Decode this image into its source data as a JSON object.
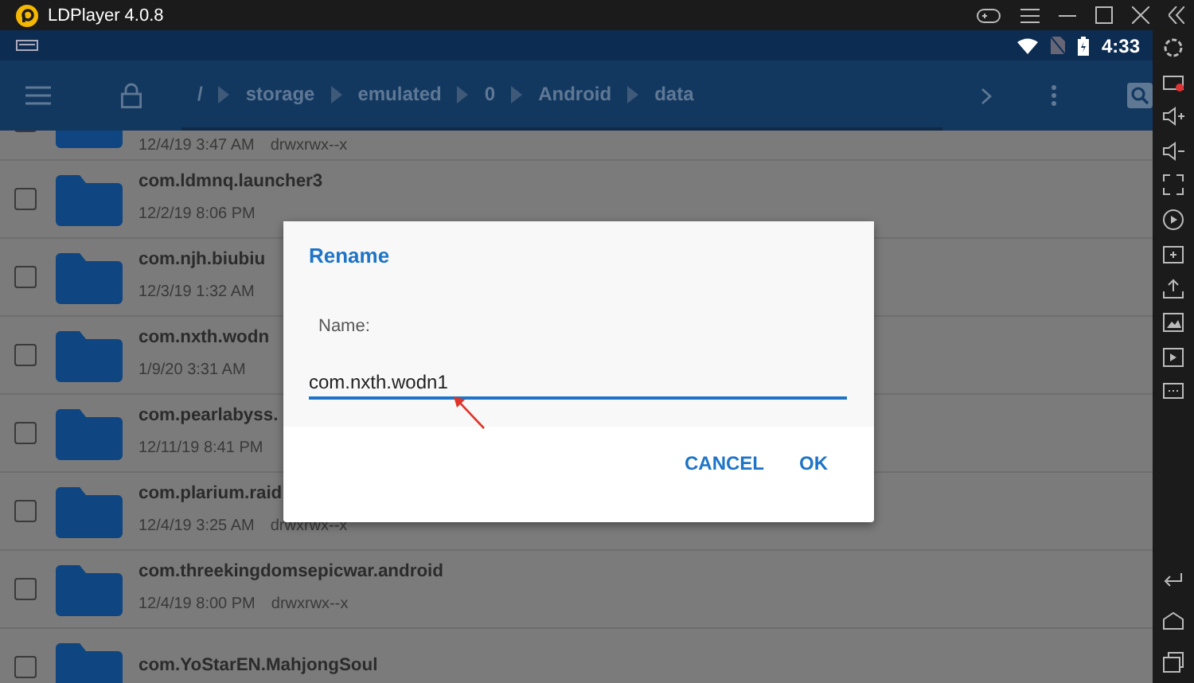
{
  "window": {
    "title": "LDPlayer 4.0.8"
  },
  "status_bar": {
    "time": "4:33"
  },
  "toolbar": {
    "path": [
      "/",
      "storage",
      "emulated",
      "0",
      "Android",
      "data"
    ]
  },
  "files": [
    {
      "date": "12/4/19 3:47 AM",
      "permissions": "drwxrwx--x",
      "checked": false
    },
    {
      "name": "com.ldmnq.launcher3",
      "date": "12/2/19 8:06 PM",
      "checked": false
    },
    {
      "name": "com.njh.biubiu",
      "date": "12/3/19 1:32 AM",
      "checked": false
    },
    {
      "name": "com.nxth.wodn",
      "date": "1/9/20 3:31 AM",
      "checked": false
    },
    {
      "name": "com.pearlabyss.",
      "date": "12/11/19 8:41 PM",
      "checked": false
    },
    {
      "name": "com.plarium.raid",
      "date": "12/4/19 3:25 AM",
      "permissions": "drwxrwx--x",
      "checked": false
    },
    {
      "name": "com.threekingdomsepicwar.android",
      "date": "12/4/19 8:00 PM",
      "permissions": "drwxrwx--x",
      "checked": false
    },
    {
      "name": "com.YoStarEN.MahjongSoul",
      "checked": false
    }
  ],
  "dialog": {
    "title": "Rename",
    "label": "Name:",
    "value": "com.nxth.wodn1",
    "buttons": [
      "CANCEL",
      "OK"
    ]
  }
}
